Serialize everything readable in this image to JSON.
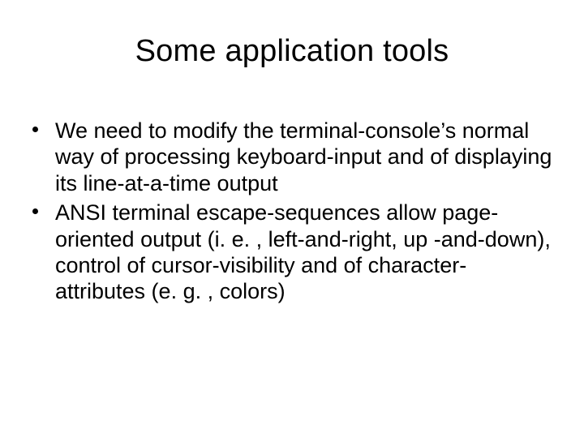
{
  "slide": {
    "title": "Some application tools",
    "bullets": [
      "We need to modify the terminal-console’s normal way of processing keyboard-input and of displaying its line-at-a-time output",
      "ANSI terminal escape-sequences allow page-oriented output (i. e. , left-and-right, up -and-down), control of cursor-visibility and of character-attributes (e. g. , colors)"
    ]
  }
}
